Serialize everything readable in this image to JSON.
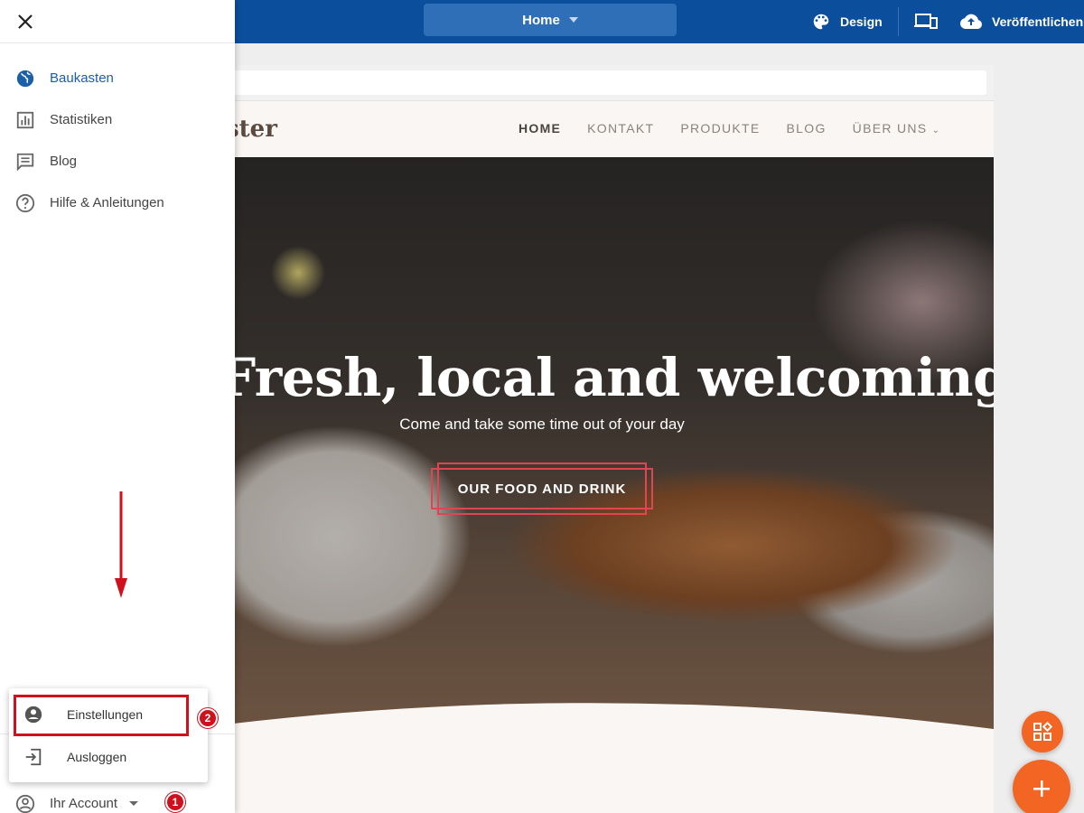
{
  "topbar": {
    "page_select_label": "Home",
    "design_label": "Design",
    "publish_label": "Veröffentlichen"
  },
  "site": {
    "logo_text": "ster",
    "nav": [
      "HOME",
      "KONTAKT",
      "PRODUKTE",
      "BLOG",
      "ÜBER UNS"
    ],
    "hero_title": "Fresh, local and welcoming",
    "hero_subtitle": "Come and take some time out of your day",
    "hero_button": "OUR FOOD AND DRINK"
  },
  "sidebar": {
    "items": [
      {
        "label": "Baukasten",
        "icon": "globe-icon",
        "active": true
      },
      {
        "label": "Statistiken",
        "icon": "chart-icon",
        "active": false
      },
      {
        "label": "Blog",
        "icon": "blog-icon",
        "active": false
      },
      {
        "label": "Hilfe & Anleitungen",
        "icon": "help-icon",
        "active": false
      }
    ],
    "account_label": "Ihr Account"
  },
  "account_menu": {
    "items": [
      {
        "label": "Einstellungen",
        "icon": "account-circle-icon"
      },
      {
        "label": "Ausloggen",
        "icon": "logout-icon"
      }
    ]
  },
  "annotations": {
    "step1": "1",
    "step2": "2"
  },
  "colors": {
    "topbar": "#0b4f9c",
    "accent_orange": "#f26522",
    "highlight_red": "#d0101c"
  }
}
